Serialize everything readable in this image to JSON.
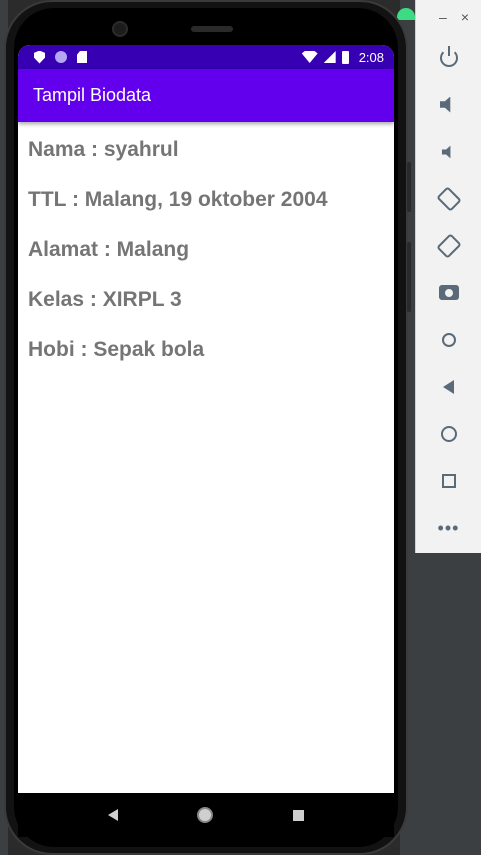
{
  "status_bar": {
    "time": "2:08",
    "background": "#3700b3"
  },
  "app_bar": {
    "title": "Tampil Biodata",
    "background": "#6200ee"
  },
  "biodata": [
    "Nama : syahrul",
    "TTL : Malang, 19 oktober 2004",
    "Alamat : Malang",
    "Kelas : XIRPL 3",
    "Hobi : Sepak bola"
  ],
  "text_color": "#757575",
  "nav_bar": {
    "icons": [
      "back-icon",
      "home-icon",
      "recents-icon"
    ]
  },
  "emulator_toolbar": {
    "window_controls": {
      "minimize": "–",
      "close": "×"
    },
    "icons": [
      "power-icon",
      "volume-up-icon",
      "volume-down-icon",
      "rotate-left-icon",
      "rotate-right-icon",
      "screenshot-icon",
      "zoom-icon",
      "back-icon",
      "home-icon",
      "overview-icon",
      "more-icon"
    ],
    "more_label": "•••"
  }
}
